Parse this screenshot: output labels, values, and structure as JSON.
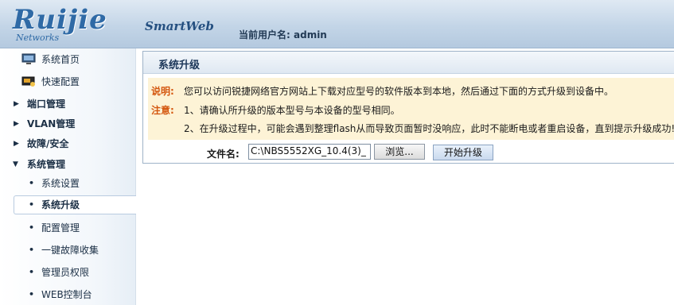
{
  "header": {
    "logo_text": "Ruijie",
    "logo_subtext": "Networks",
    "product_name": "SmartWeb",
    "user_label": "当前用户名:",
    "username": "admin"
  },
  "sidebar": {
    "items": [
      {
        "label": "系统首页",
        "icon": "monitor-icon",
        "type": "link"
      },
      {
        "label": "快速配置",
        "icon": "wizard-icon",
        "type": "link"
      },
      {
        "label": "端口管理",
        "type": "group",
        "expanded": false
      },
      {
        "label": "VLAN管理",
        "type": "group",
        "expanded": false
      },
      {
        "label": "故障/安全",
        "type": "group",
        "expanded": false
      },
      {
        "label": "系统管理",
        "type": "group",
        "expanded": true
      },
      {
        "label": "系统设置",
        "type": "sub"
      },
      {
        "label": "系统升级",
        "type": "sub",
        "active": true
      },
      {
        "label": "配置管理",
        "type": "sub"
      },
      {
        "label": "一键故障收集",
        "type": "sub"
      },
      {
        "label": "管理员权限",
        "type": "sub"
      },
      {
        "label": "WEB控制台",
        "type": "sub"
      }
    ]
  },
  "main": {
    "title": "系统升级",
    "description_key": "说明:",
    "description": "您可以访问锐捷网络官方网站上下载对应型号的软件版本到本地，然后通过下面的方式升级到设备中。",
    "note_key": "注意:",
    "note_1": "1、请确认所升级的版本型号与本设备的型号相同。",
    "note_2": "2、在升级过程中，可能会遇到整理flash从而导致页面暂时没响应，此时不能断电或者重启设备，直到提示升级成功!",
    "file_label": "文件名:",
    "file_value": "C:\\NBS5552XG_10.4(3)_",
    "browse_label": "浏览...",
    "upgrade_label": "开始升级"
  },
  "colors": {
    "header_bg": "#c3d5e7",
    "accent_key": "#d4570f",
    "notice_bg": "#fdf3d6",
    "title_text": "#1b3658"
  }
}
